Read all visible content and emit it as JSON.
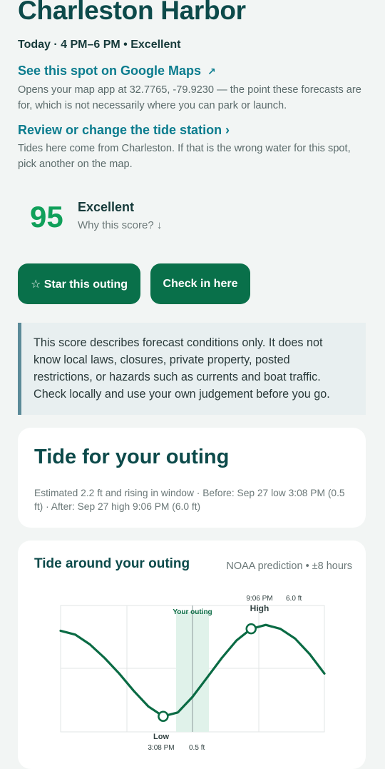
{
  "header": {
    "title": "Charleston Harbor",
    "subtitle": "Today · 4 PM–6 PM • Excellent"
  },
  "maps": {
    "link_label": "See this spot on Google Maps",
    "link_icon": "external-arrow-icon",
    "note": "Opens your map app at 32.7765, -79.9230 — the point these forecasts are for, which is not necessarily where you can park or launch."
  },
  "station": {
    "link_label": "Review or change the tide station ›",
    "note": "Tides here come from Charleston. If that is the wrong water for this spot, pick another on the map."
  },
  "score": {
    "value": "95",
    "label": "Excellent",
    "why": "Why this score? ↓",
    "color": "#10a05a"
  },
  "actions": {
    "star_label": "☆ Star this outing",
    "checkin_label": "Check in here",
    "button_color": "#09704a"
  },
  "disclaimer": "This score describes forecast conditions only. It does not know local laws, closures, private property, posted restrictions, or hazards such as currents and boat traffic. Check locally and use your own judgement before you go.",
  "tide_summary": {
    "title": "Tide for your outing",
    "text": "Estimated 2.2 ft and rising in window · Before: Sep 27 low 3:08 PM (0.5 ft) · After: Sep 27 high 9:06 PM (6.0 ft)"
  },
  "tide_chart": {
    "title": "Tide around your outing",
    "meta": "NOAA prediction • ±8 hours",
    "outing_label": "Your outing",
    "high": {
      "label": "High",
      "time": "9:06 PM",
      "value": "6.0",
      "unit": "ft"
    },
    "low": {
      "label": "Low",
      "time": "3:08 PM",
      "value": "0.5",
      "unit": "ft"
    },
    "line_color": "#0a6b44"
  },
  "chart_data": {
    "type": "line",
    "title": "Tide around your outing",
    "xlabel": "",
    "ylabel": "",
    "x_unit": "hours relative to outing start",
    "x": [
      -8,
      -7,
      -6,
      -5,
      -4,
      -3,
      -2,
      -1,
      0,
      1,
      2,
      3,
      4,
      5,
      6,
      7,
      8,
      9,
      10
    ],
    "series": [
      {
        "values": [
          5.2,
          5.0,
          4.5,
          3.8,
          3.0,
          2.1,
          1.3,
          0.8,
          1.0,
          1.8,
          2.8,
          3.8,
          4.7,
          5.3,
          5.5,
          5.3,
          4.8,
          4.0,
          3.0
        ]
      }
    ],
    "ylim": [
      0,
      6.5
    ],
    "xlim": [
      -8,
      10
    ],
    "highlight_window": [
      0,
      2
    ],
    "annotations": [
      {
        "label": "Low",
        "time": "3:08 PM",
        "value": 0.5,
        "x": -1.0
      },
      {
        "label": "High",
        "time": "9:06 PM",
        "value": 6.0,
        "x": 5.0
      }
    ],
    "grid": true
  }
}
